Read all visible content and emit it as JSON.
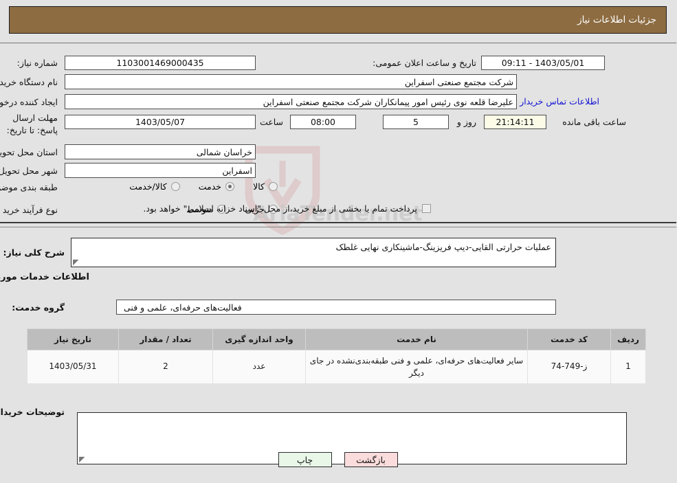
{
  "header": {
    "title": "جزئیات اطلاعات نیاز"
  },
  "watermark": {
    "text": "AriaTender.net"
  },
  "need_info": {
    "need_number_label": "شماره نیاز:",
    "need_number_value": "1103001469000435",
    "announce_datetime_label": "تاریخ و ساعت اعلان عمومی:",
    "announce_datetime_value": "1403/05/01 - 09:11",
    "buyer_org_label": "نام دستگاه خریدار:",
    "buyer_org_value": "شرکت مجتمع صنعتی اسفراین",
    "buyer_org_value2": "",
    "requester_label": "ایجاد کننده درخواست:",
    "requester_value": "علیرضا قلعه نوی رئیس امور پیمانکاران شرکت مجتمع صنعتی اسفراین",
    "buyer_contact_link": "اطلاعات تماس خریدار",
    "deadline_label": "مهلت ارسال پاسخ: تا تاریخ:",
    "deadline_date": "1403/05/07",
    "deadline_hour_label": "ساعت",
    "deadline_hour": "08:00",
    "remaining_days": "5",
    "remaining_days_label": "روز و",
    "remaining_time": "21:14:11",
    "remaining_time_label": "ساعت باقی مانده",
    "province_label": "استان محل تحویل:",
    "province_value": "خراسان شمالی",
    "city_label": "شهر محل تحویل:",
    "city_value": "اسفراین",
    "category_label": "طبقه بندی موضوعی:",
    "category_options": [
      {
        "label": "کالا",
        "selected": false
      },
      {
        "label": "خدمت",
        "selected": true
      },
      {
        "label": "کالا/خدمت",
        "selected": false
      }
    ],
    "process_label": "نوع فرآیند خرید :",
    "process_options": [
      {
        "label": "جزیی",
        "selected": false
      },
      {
        "label": "متوسط",
        "selected": false
      }
    ],
    "payment_checkbox_label": "پرداخت تمام یا بخشی از مبلغ خرید،از محل \"اسناد خزانه اسلامی\" خواهد بود.",
    "payment_checked": false
  },
  "description": {
    "label": "شرح کلی نیاز:",
    "value": "عملیات حرارتی القایی-دیپ فریزینگ-ماشینکاری نهایی غلطک"
  },
  "services": {
    "section_title": "اطلاعات خدمات مورد نیاز",
    "group_label": "گروه خدمت:",
    "group_value": "فعالیت‌های حرفه‌ای، علمی و فنی",
    "table": {
      "headers": [
        "ردیف",
        "کد خدمت",
        "نام خدمت",
        "واحد اندازه گیری",
        "تعداد / مقدار",
        "تاریخ نیاز"
      ],
      "rows": [
        {
          "row": "1",
          "code": "ز-749-74",
          "name": "سایر فعالیت‌های حرفه‌ای، علمی و فنی طبقه‌بندی‌نشده در جای دیگر",
          "unit": "عدد",
          "qty": "2",
          "date": "1403/05/31"
        }
      ]
    }
  },
  "buyer_notes": {
    "label": "توضیحات خریدار:",
    "value": ""
  },
  "footer": {
    "print_label": "چاپ",
    "back_label": "بازگشت"
  }
}
